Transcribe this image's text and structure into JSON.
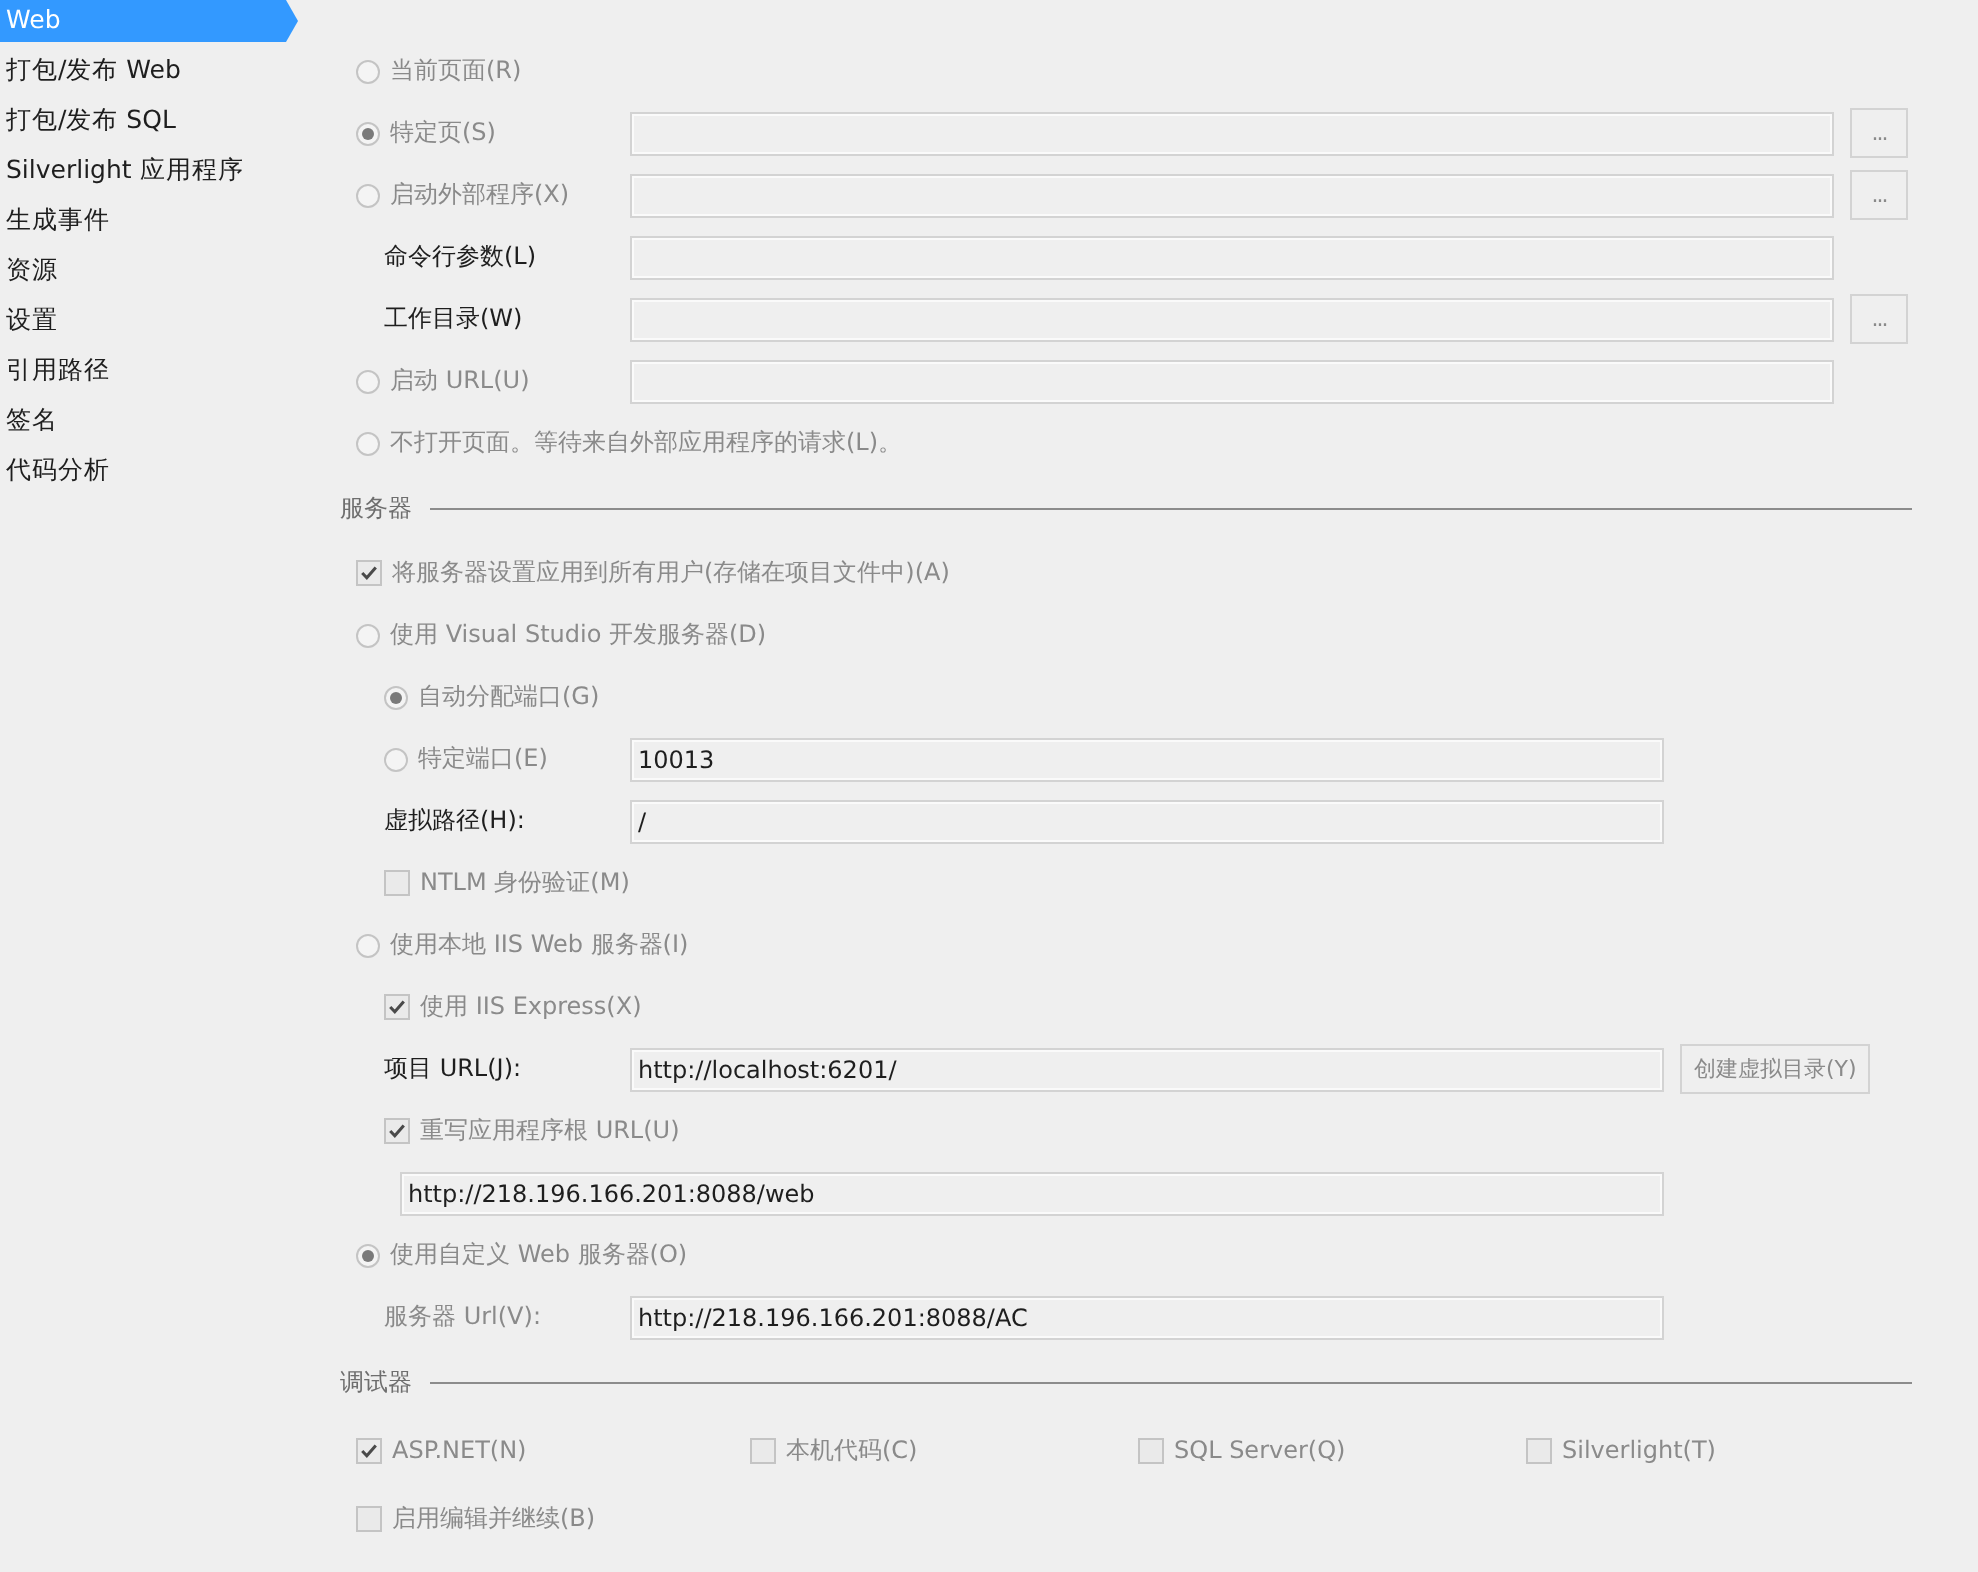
{
  "sidebar": {
    "items": [
      {
        "label": "Web",
        "selected": true
      },
      {
        "label": "打包/发布 Web",
        "selected": false
      },
      {
        "label": "打包/发布 SQL",
        "selected": false
      },
      {
        "label": "Silverlight 应用程序",
        "selected": false
      },
      {
        "label": "生成事件",
        "selected": false
      },
      {
        "label": "资源",
        "selected": false
      },
      {
        "label": "设置",
        "selected": false
      },
      {
        "label": "引用路径",
        "selected": false
      },
      {
        "label": "签名",
        "selected": false
      },
      {
        "label": "代码分析",
        "selected": false
      }
    ]
  },
  "start_action": {
    "items": [
      {
        "kind": "radio",
        "label": "当前页面(R)",
        "selected": false,
        "disabled": true
      },
      {
        "kind": "radio",
        "label": "特定页(S)",
        "selected": true,
        "disabled": true,
        "field": true,
        "browse_button": "..."
      },
      {
        "kind": "radio",
        "label": "启动外部程序(X)",
        "selected": false,
        "disabled": true,
        "field": true,
        "browse_button": "...",
        "children": [
          {
            "kind": "label",
            "label": "命令行参数(L)",
            "disabled": false,
            "field": true
          },
          {
            "kind": "label",
            "label": "工作目录(W)",
            "disabled": false,
            "field": true,
            "browse_button": "..."
          }
        ]
      },
      {
        "kind": "radio",
        "label": "启动 URL(U)",
        "selected": false,
        "disabled": true,
        "field": true
      },
      {
        "kind": "radio",
        "label": "不打开页面。等待来自外部应用程序的请求(L)。",
        "selected": false,
        "disabled": true
      }
    ]
  },
  "servers": {
    "title": "服务器",
    "items": [
      {
        "kind": "checkbox",
        "label": "将服务器设置应用到所有用户(存储在项目文件中)(A)",
        "checked": true,
        "disabled": true
      },
      {
        "kind": "radio",
        "label": "使用 Visual Studio 开发服务器(D)",
        "selected": false,
        "disabled": true,
        "children": [
          {
            "kind": "radio",
            "label": "自动分配端口(G)",
            "selected": true,
            "disabled": true
          },
          {
            "kind": "radio",
            "label": "特定端口(E)",
            "selected": false,
            "disabled": true,
            "field_value": "10013"
          },
          {
            "kind": "label",
            "label": "虚拟路径(H):",
            "disabled": false,
            "field_value": "/"
          },
          {
            "kind": "checkbox",
            "label": "NTLM 身份验证(M)",
            "checked": false,
            "disabled": true
          }
        ]
      },
      {
        "kind": "radio",
        "label": "使用本地 IIS Web 服务器(I)",
        "selected": false,
        "disabled": true,
        "children": [
          {
            "kind": "checkbox",
            "label": "使用 IIS Express(X)",
            "checked": true,
            "disabled": true
          },
          {
            "kind": "label",
            "label": "项目 URL(J):",
            "disabled": false,
            "field_value": "http://localhost:6201/",
            "action_button": "创建虚拟目录(Y)"
          },
          {
            "kind": "checkbox",
            "label": "重写应用程序根 URL(U)",
            "checked": true,
            "disabled": true
          },
          {
            "kind": "field",
            "field_value": "http://218.196.166.201:8088/web"
          }
        ]
      },
      {
        "kind": "radio",
        "label": "使用自定义 Web 服务器(O)",
        "selected": true,
        "disabled": true,
        "children": [
          {
            "kind": "label",
            "label": "服务器 Url(V):",
            "disabled": true,
            "field_value": "http://218.196.166.201:8088/AC"
          }
        ]
      }
    ]
  },
  "debuggers": {
    "title": "调试器",
    "items": [
      {
        "kind": "checkbox_group",
        "items": [
          {
            "kind": "checkbox",
            "label": "ASP.NET(N)",
            "checked": true,
            "disabled": true
          },
          {
            "kind": "checkbox",
            "label": "本机代码(C)",
            "checked": false,
            "disabled": true
          },
          {
            "kind": "checkbox",
            "label": "SQL Server(Q)",
            "checked": false,
            "disabled": true
          },
          {
            "kind": "checkbox",
            "label": "Silverlight(T)",
            "checked": false,
            "disabled": true
          }
        ]
      },
      {
        "kind": "checkbox",
        "label": "启用编辑并继续(B)",
        "checked": false,
        "disabled": true
      }
    ]
  }
}
